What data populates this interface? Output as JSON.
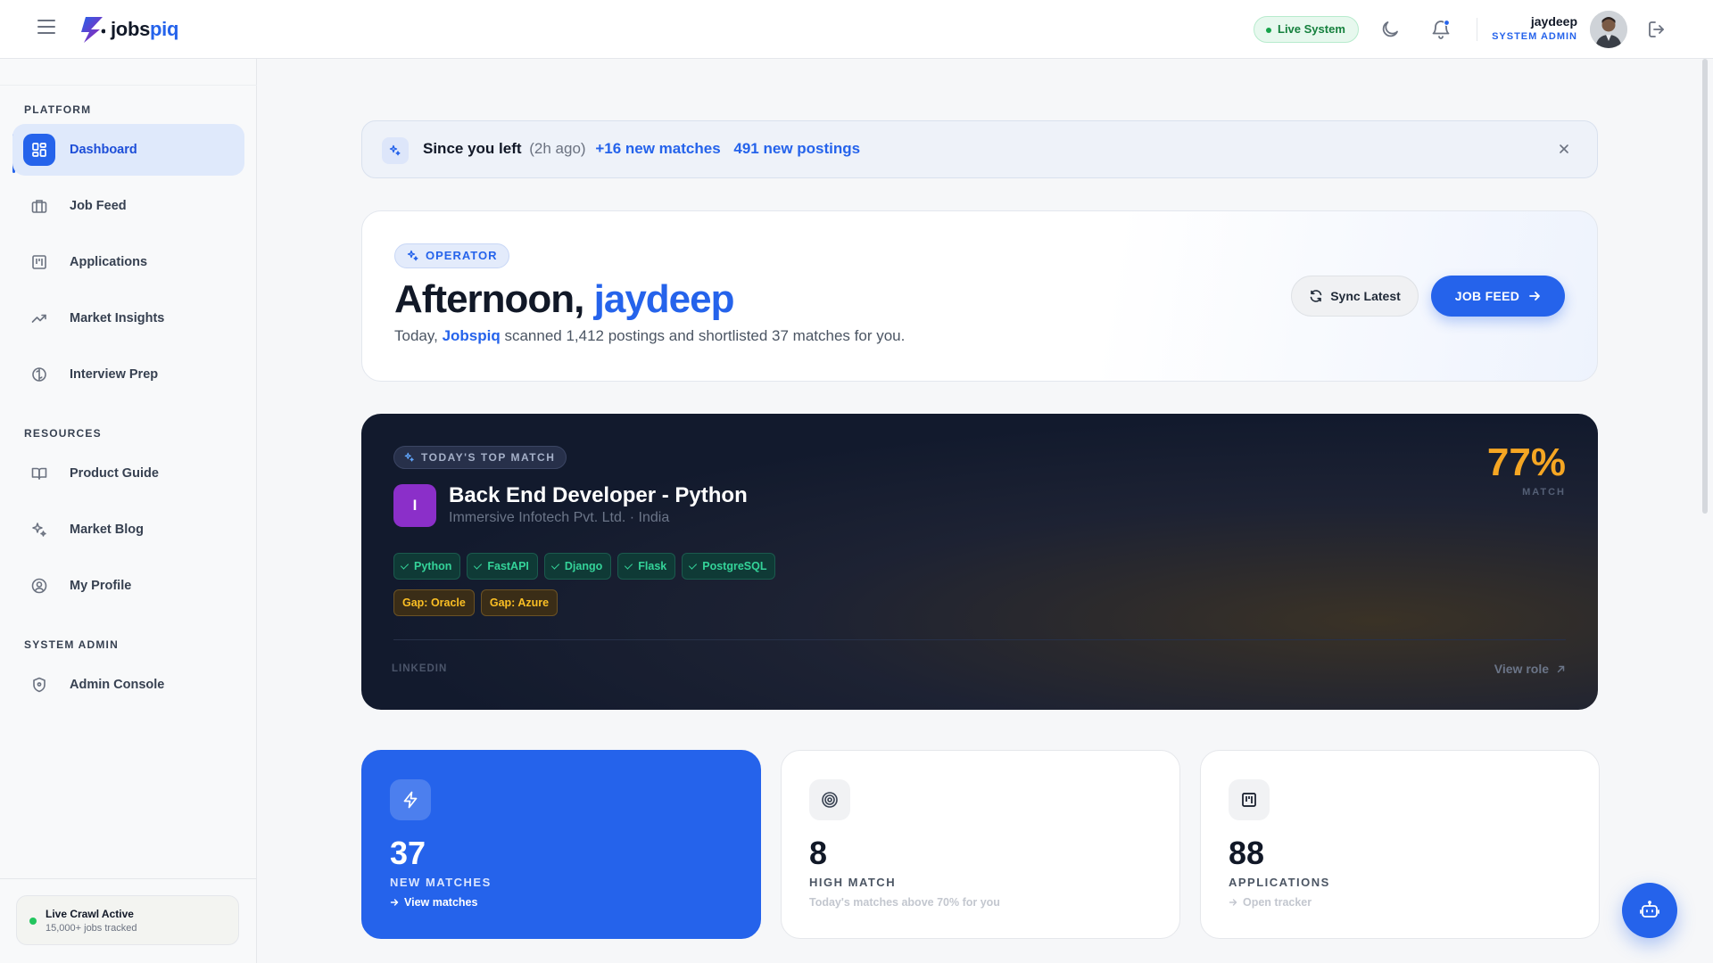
{
  "header": {
    "brand_prefix": "jobs",
    "brand_suffix": "piq",
    "live_status": "Live System",
    "user_name": "jaydeep",
    "user_role": "SYSTEM ADMIN"
  },
  "sidebar": {
    "sections": {
      "platform": "PLATFORM",
      "resources": "RESOURCES",
      "admin": "SYSTEM ADMIN"
    },
    "items": [
      {
        "label": "Dashboard",
        "icon": "dashboard-grid-icon",
        "active": true
      },
      {
        "label": "Job Feed",
        "icon": "briefcase-icon"
      },
      {
        "label": "Applications",
        "icon": "kanban-icon"
      },
      {
        "label": "Market Insights",
        "icon": "trend-up-icon"
      },
      {
        "label": "Interview Prep",
        "icon": "brain-icon"
      },
      {
        "label": "Product Guide",
        "icon": "book-open-icon"
      },
      {
        "label": "Market Blog",
        "icon": "sparkles-icon"
      },
      {
        "label": "My Profile",
        "icon": "user-circle-icon"
      },
      {
        "label": "Admin Console",
        "icon": "shield-icon"
      }
    ],
    "crawl": {
      "title": "Live Crawl Active",
      "subtitle": "15,000+ jobs tracked"
    }
  },
  "since_bar": {
    "title": "Since you left",
    "ago": "(2h ago)",
    "new_matches": "+16 new matches",
    "new_postings": "491 new postings"
  },
  "hero": {
    "badge": "OPERATOR",
    "greeting": "Afternoon, ",
    "name": "jaydeep",
    "sub_prefix": "Today, ",
    "sub_brand": "Jobspiq",
    "sub_suffix": " scanned 1,412 postings and shortlisted 37 matches for you.",
    "sync_label": "Sync Latest",
    "jobfeed_label": "JOB FEED"
  },
  "top_match": {
    "badge": "TODAY'S TOP MATCH",
    "company_initial": "I",
    "title": "Back End Developer - Python",
    "company": "Immersive Infotech Pvt. Ltd. · India",
    "match_pct": "77%",
    "match_label": "MATCH",
    "skills": [
      "Python",
      "FastAPI",
      "Django",
      "Flask",
      "PostgreSQL"
    ],
    "gaps": [
      "Gap: Oracle",
      "Gap: Azure"
    ],
    "source": "LINKEDIN",
    "view_label": "View role"
  },
  "stats": [
    {
      "value": "37",
      "label": "NEW MATCHES",
      "footer": "View matches",
      "icon": "lightning-icon"
    },
    {
      "value": "8",
      "label": "HIGH MATCH",
      "footer": "Today's matches above 70% for you",
      "icon": "target-icon"
    },
    {
      "value": "88",
      "label": "APPLICATIONS",
      "footer": "Open tracker",
      "icon": "kanban-icon"
    }
  ],
  "colors": {
    "accent": "#2563eb",
    "match_orange": "#f5a623",
    "skill_green": "#34d399",
    "gap_amber": "#fbbf24",
    "brand_purple": "#8b2fc9"
  }
}
